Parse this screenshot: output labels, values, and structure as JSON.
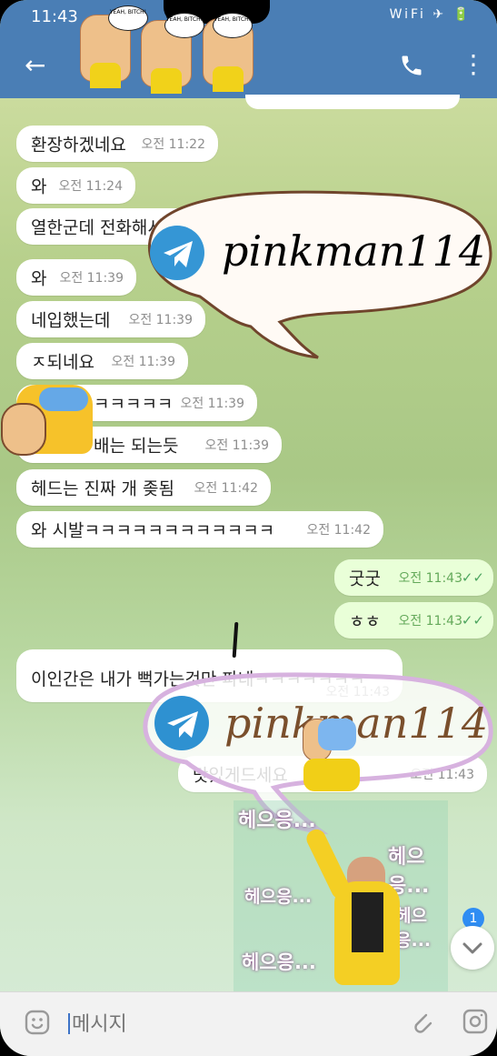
{
  "status_bar": {
    "time": "11:43",
    "icons": "WiFi ✈ 🔋"
  },
  "header": {
    "back_label": "←",
    "call_icon": "phone-icon",
    "more_icon": "more-icon",
    "stickers": [
      "YEAH, BITCH!",
      "YEAH, BITCH!",
      "YEAH, BITCH!"
    ]
  },
  "messages": [
    {
      "text": "환장하겠네요",
      "time": "오전 11:22"
    },
    {
      "text": "와",
      "time": "오전 11:24"
    },
    {
      "text": "열한군데 전화해서 거우 찾음",
      "time": "오전 11:24"
    },
    {
      "text": "와",
      "time": "오전 11:39"
    },
    {
      "text": "네입했는데",
      "time": "오전 11:39"
    },
    {
      "text": "ㅈ되네요",
      "time": "오전 11:39"
    },
    {
      "text": "ㅋㅋㅋㅋㅋ",
      "time": "오전 11:39"
    },
    {
      "text": "배는 되는듯",
      "time": "오전 11:39"
    },
    {
      "text": "헤드는 진짜 개 좆됨",
      "time": "오전 11:42"
    },
    {
      "text": "와 시발ㅋㅋㅋㅋㅋㅋㅋㅋㅋㅋㅋㅋ",
      "time": "오전 11:42"
    },
    {
      "text": "굿굿",
      "time": "오전 11:43",
      "outgoing": true
    },
    {
      "text": "ㅎㅎ",
      "time": "오전 11:43",
      "outgoing": true
    },
    {
      "text": "이인간은 내가 뻑가는것만 파네ㅋㅋㅋㅋㅋㅋㅋ",
      "time": "오전 11:43"
    },
    {
      "text": "맛있게드세요",
      "time": "오전 11:43"
    }
  ],
  "watermarks": [
    "pinkman114",
    "pinkman114"
  ],
  "sticker_texts": [
    "헤으응...",
    "헤으응...",
    "헤으응...",
    "헤으응...",
    "헤으응..."
  ],
  "input": {
    "placeholder": "메시지"
  },
  "scroll_badge": "1",
  "colors": {
    "header": "#4a7eb5",
    "accent": "#2f8df3"
  }
}
